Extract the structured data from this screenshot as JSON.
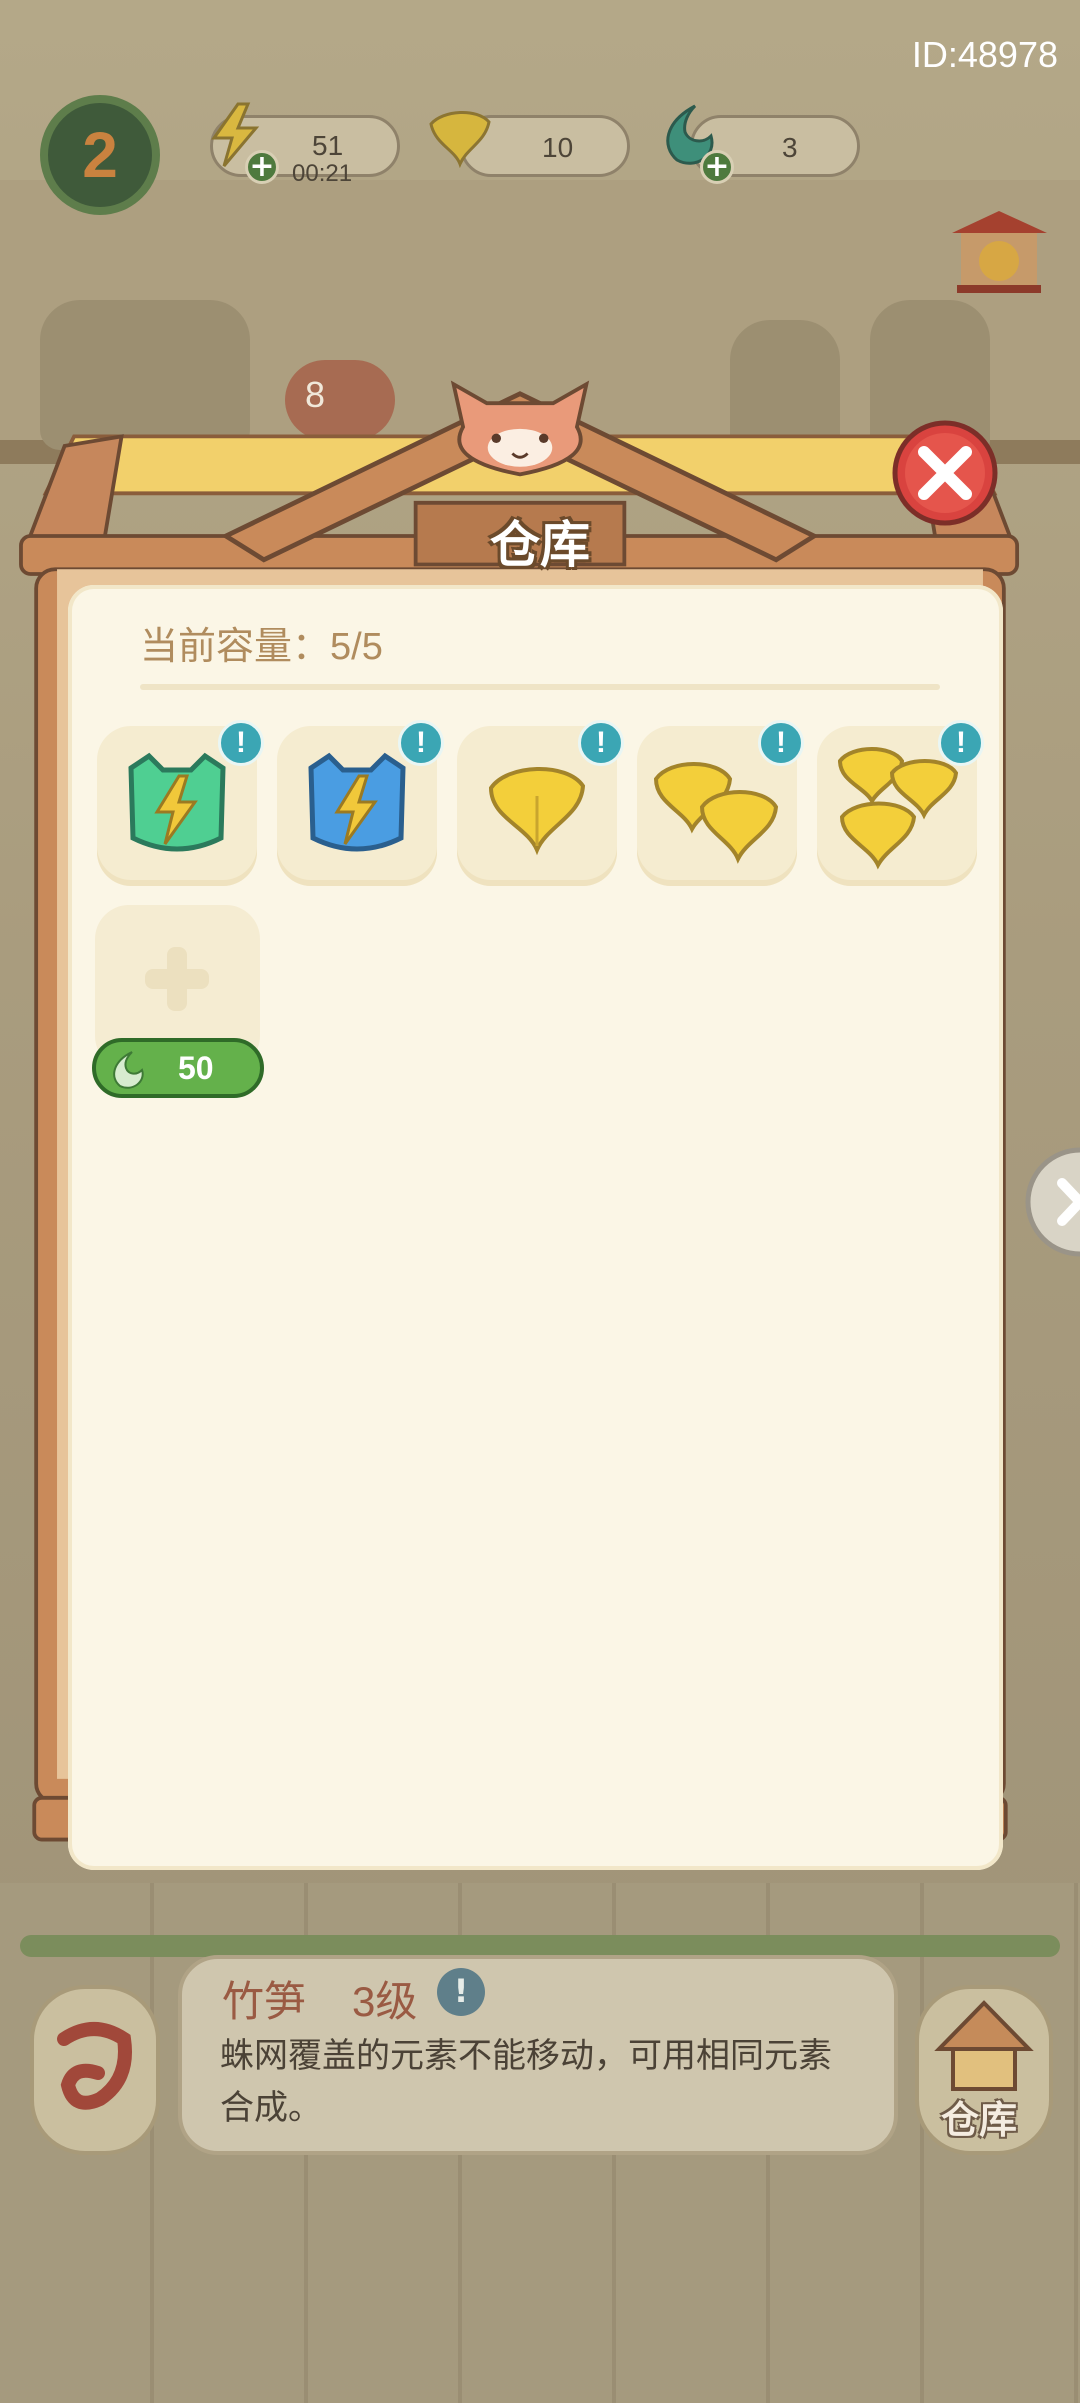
{
  "hud": {
    "user_id": "ID:48978",
    "level": "2",
    "energy": {
      "value": "51",
      "timer": "00:21"
    },
    "ginkgo": {
      "value": "10"
    },
    "drops": {
      "value": "3"
    },
    "scene_bubble_count": "8"
  },
  "warehouse": {
    "title": "仓库",
    "capacity_text": "当前容量：5/5",
    "items": [
      {
        "icon": "green-energy-icon",
        "badge": "!"
      },
      {
        "icon": "blue-energy-icon",
        "badge": "!"
      },
      {
        "icon": "ginkgo-leaf-icon",
        "badge": "!"
      },
      {
        "icon": "double-ginkgo-icon",
        "badge": "!"
      },
      {
        "icon": "triple-ginkgo-icon",
        "badge": "!"
      }
    ],
    "expand_price": "50"
  },
  "info": {
    "name": "竹笋",
    "level": "3级",
    "badge": "!",
    "description": "蛛网覆盖的元素不能移动，可用相同元素合成。"
  },
  "buttons": {
    "warehouse_label": "仓库"
  },
  "colors": {
    "paper": "#fbf6e6",
    "wood": "#c98a5a",
    "close_red": "#d9433f",
    "warn_teal": "#3ba6b4",
    "price_green": "#64b14b"
  }
}
